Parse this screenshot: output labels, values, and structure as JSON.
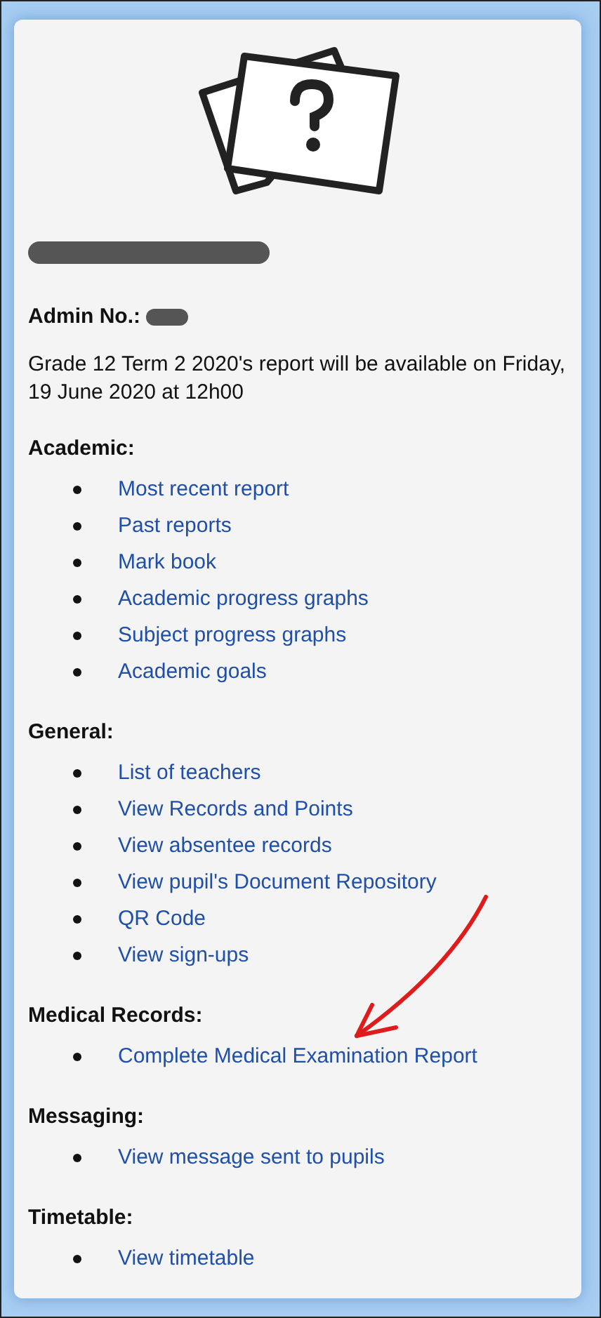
{
  "admin_label": "Admin No.:",
  "notice": "Grade 12 Term 2 2020's report will be available on Friday, 19 June 2020 at 12h00",
  "sections": [
    {
      "heading": "Academic:",
      "links": [
        "Most recent report",
        "Past reports",
        "Mark book",
        "Academic progress graphs",
        "Subject progress graphs",
        "Academic goals"
      ]
    },
    {
      "heading": "General:",
      "links": [
        "List of teachers",
        "View Records and Points",
        "View absentee records",
        "View pupil's Document Repository",
        "QR Code",
        "View sign-ups"
      ]
    },
    {
      "heading": "Medical Records:",
      "links": [
        "Complete Medical Examination Report"
      ]
    },
    {
      "heading": "Messaging:",
      "links": [
        "View message sent to pupils"
      ]
    },
    {
      "heading": "Timetable:",
      "links": [
        "View timetable"
      ]
    }
  ]
}
